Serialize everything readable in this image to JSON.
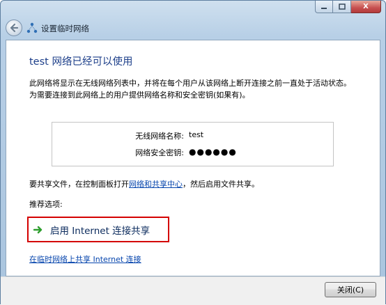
{
  "window": {
    "title": "设置临时网络",
    "close_glyph": "X"
  },
  "content": {
    "heading": "test 网络已经可以使用",
    "description": "此网络将显示在无线网络列表中，并将在每个用户从该网络上断开连接之前一直处于活动状态。为需要连接到此网络上的用户提供网络名称和安全密钥(如果有)。",
    "info": {
      "name_label": "无线网络名称:",
      "name_value": "test",
      "key_label": "网络安全密钥:",
      "key_value": "●●●●●●"
    },
    "share": {
      "prefix": "要共享文件，在控制面板打开",
      "link": "网络和共享中心",
      "suffix": "，然后启用文件共享。"
    },
    "recommend_label": "推荐选项:",
    "ics_command": "启用 Internet 连接共享",
    "adhoc_link": "在临时网络上共享 Internet 连接"
  },
  "footer": {
    "close_label": "关闭(C)"
  },
  "colors": {
    "heading": "#1d3f8a",
    "link": "#0645ad",
    "highlight_border": "#d40000",
    "arrow": "#2e9e2e"
  },
  "icons": {
    "back": "back-arrow-icon",
    "network": "adhoc-network-icon",
    "command": "green-arrow-icon"
  }
}
